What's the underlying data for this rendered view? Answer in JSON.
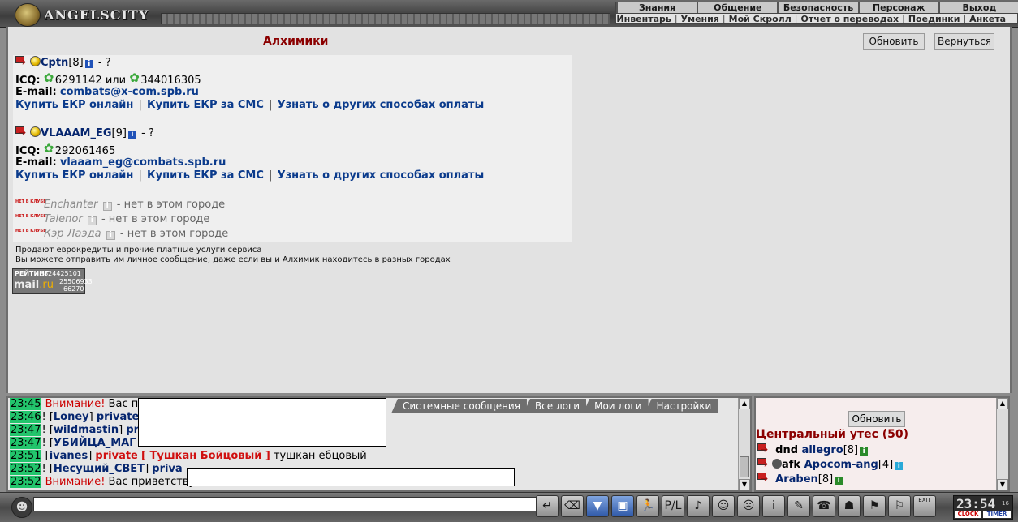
{
  "header": {
    "logo_text": "ANGELSCITY",
    "menu_top": [
      "Знания",
      "Общение",
      "Безопасность",
      "Персонаж",
      "Выход"
    ],
    "menu_sub": [
      "Инвентарь",
      "Умения",
      "Мой Скролл",
      "Отчет о переводах",
      "Поединки",
      "Анкета"
    ]
  },
  "main": {
    "title": "Алхимики",
    "refresh_label": "Обновить",
    "back_label": "Вернуться",
    "merchants": [
      {
        "nick": "Cptn",
        "level": "[8]",
        "suffix": " - ?",
        "icq_label": "ICQ:",
        "icq_1": "6291142",
        "icq_or": "или",
        "icq_2": "344016305",
        "email_label": "E-mail:",
        "email": "combats@x-com.spb.ru",
        "link_online": "Купить ЕКР онлайн",
        "link_sms": "Купить ЕКР за СМС",
        "link_other": "Узнать о других способах оплаты"
      },
      {
        "nick": "VLAAAM_EG",
        "level": "[9]",
        "suffix": " - ?",
        "icq_label": "ICQ:",
        "icq_1": "292061465",
        "email_label": "E-mail:",
        "email": "vlaaam_eg@combats.spb.ru",
        "link_online": "Купить ЕКР онлайн",
        "link_sms": "Купить ЕКР за СМС",
        "link_other": "Узнать о других способах оплаты"
      }
    ],
    "offline_badge": "НЕТ В КЛУБЕ",
    "offline": [
      {
        "name": "Enchanter",
        "status": "- нет в этом городе"
      },
      {
        "name": "Talenor",
        "status": "- нет в этом городе"
      },
      {
        "name": "Кэр Лаэда",
        "status": "- нет в этом городе"
      }
    ],
    "desc_1": "Продают еврокредиты и прочие платные услуги сервиса",
    "desc_2": "Вы можете отправить им личное сообщение, даже если вы и Алхимик находитесь в разных городах",
    "counter": {
      "label": "РЕЙТИНГ",
      "brand": "mail",
      "brand_suffix": ".ru",
      "n1": "8824425101",
      "n2": "25506933",
      "n3": "66270"
    }
  },
  "chat": {
    "tabs": [
      "Системные сообщения",
      "Все логи",
      "Мои логи",
      "Настройки"
    ],
    "messages": [
      {
        "time": "23:45",
        "text_1": "Внимание!",
        "text_2": " Вас п"
      },
      {
        "time": "23:46",
        "user": "Loney",
        "priv": "private"
      },
      {
        "time": "23:47",
        "user": "wildmastin",
        "priv": "pr"
      },
      {
        "time": "23:47",
        "user": "УБИЙЦА_МАГ"
      },
      {
        "time": "23:51",
        "user": "ivanes",
        "priv": "private",
        "to": "[ Тушкан Бойцовый ]",
        "text": " тушкан ебцовый"
      },
      {
        "time": "23:52",
        "user": "Несущий_СВЕТ",
        "priv": "priva"
      },
      {
        "time": "23:52",
        "text_1": "Внимание!",
        "text_2": " Вас приветству"
      }
    ]
  },
  "location": {
    "refresh_label": "Обновить",
    "title": "Центральный утес (50)",
    "players": [
      {
        "prefix": "dnd ",
        "nick": "allegro",
        "level": "[8]",
        "info": "i"
      },
      {
        "prefix": "afk ",
        "nick": "Apocom-ang",
        "level": "[4]",
        "info": "i"
      },
      {
        "prefix": "",
        "nick": "Araben",
        "level": "[8]",
        "info": "i"
      }
    ]
  },
  "toolbar": {
    "input_value": "",
    "clock_time": "23:54",
    "clock_sec": "16",
    "clock_label": "CLOCK",
    "timer_label": "TIMER",
    "exit_label": "EXIT"
  }
}
